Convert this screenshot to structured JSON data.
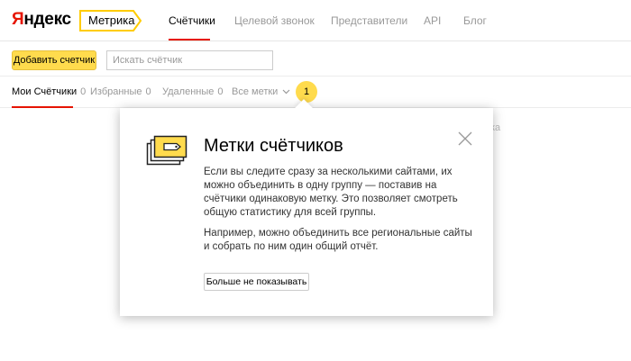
{
  "header": {
    "logo": {
      "first_letter": "Я",
      "rest": "ндекс"
    },
    "product_tag": "Метрика",
    "nav": [
      {
        "label": "Счётчики",
        "active": true
      },
      {
        "label": "Целевой звонок",
        "active": false
      },
      {
        "label": "Представители",
        "active": false
      },
      {
        "label": "API",
        "active": false
      },
      {
        "label": "Блог",
        "active": false
      }
    ]
  },
  "toolbar": {
    "add_label": "Добавить счетчик",
    "search_placeholder": "Искать счётчик",
    "search_value": ""
  },
  "tabs": [
    {
      "label": "Мои Счётчики",
      "count": "0",
      "active": true
    },
    {
      "label": "Избранные",
      "count": "0",
      "active": false
    },
    {
      "label": "Удаленные",
      "count": "0",
      "active": false
    },
    {
      "label": "Все метки",
      "count": "",
      "active": false
    }
  ],
  "badge": "1",
  "background_fragment": "ка",
  "popup": {
    "title": "Метки счётчиков",
    "paragraph1": "Если вы следите сразу за несколькими сайтами, их можно объединить в одну группу — поставив на счётчики одинаковую метку. Это позволяет смотреть общую статистику для всей группы.",
    "paragraph2": "Например, можно объединить все региональные сайты и собрать по ним один общий отчёт.",
    "dismiss_label": "Больше не показывать",
    "icon": "tag-folders-icon"
  },
  "colors": {
    "accent_yellow": "#ffdb4d",
    "brand_red": "#e61400",
    "muted_text": "#999999"
  }
}
